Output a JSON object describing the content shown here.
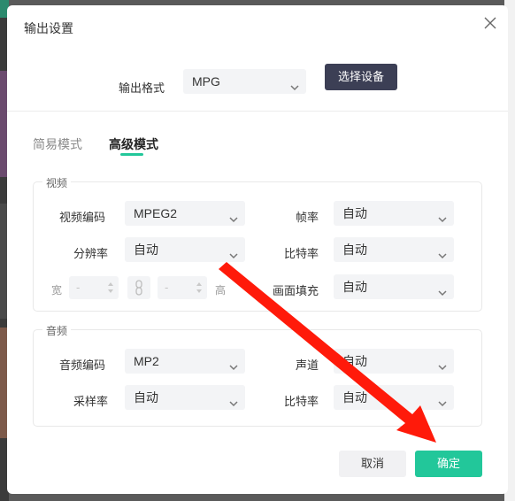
{
  "dialog": {
    "title": "输出设置",
    "format_label": "输出格式",
    "format_value": "MPG",
    "choose_device_label": "选择设备"
  },
  "tabs": [
    {
      "label": "简易模式",
      "active": false
    },
    {
      "label": "高级模式",
      "active": true
    }
  ],
  "video": {
    "group_title": "视频",
    "codec_label": "视频编码",
    "codec_value": "MPEG2",
    "framerate_label": "帧率",
    "framerate_value": "自动",
    "resolution_label": "分辨率",
    "resolution_value": "自动",
    "bitrate_label": "比特率",
    "bitrate_value": "自动",
    "width_label": "宽",
    "width_value": "-",
    "height_label": "高",
    "height_value": "-",
    "fill_label": "画面填充",
    "fill_value": "自动"
  },
  "audio": {
    "group_title": "音频",
    "codec_label": "音频编码",
    "codec_value": "MP2",
    "channel_label": "声道",
    "channel_value": "自动",
    "samplerate_label": "采样率",
    "samplerate_value": "自动",
    "bitrate_label": "比特率",
    "bitrate_value": "自动"
  },
  "buttons": {
    "cancel": "取消",
    "ok": "确定"
  },
  "colors": {
    "accent": "#22c79a",
    "device_button": "#3c3f55",
    "arrow": "#ff1a0a"
  },
  "icons": {
    "close": "close-icon",
    "dropdown": "chevron-down-icon",
    "link": "link-icon",
    "spinner": "spinner-arrows-icon",
    "annotation": "red-arrow-annotation"
  }
}
